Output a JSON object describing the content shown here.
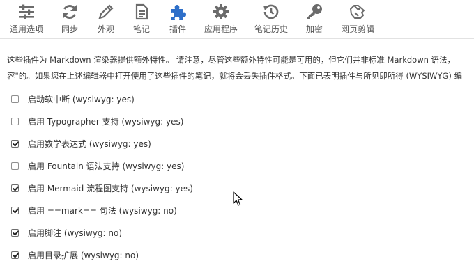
{
  "toolbar": {
    "tabs": [
      {
        "label": "通用选项",
        "icon": "sliders-icon",
        "active": false
      },
      {
        "label": "同步",
        "icon": "sync-icon",
        "active": false
      },
      {
        "label": "外观",
        "icon": "pencil-icon",
        "active": false
      },
      {
        "label": "笔记",
        "icon": "note-icon",
        "active": false
      },
      {
        "label": "插件",
        "icon": "puzzle-icon",
        "active": true
      },
      {
        "label": "应用程序",
        "icon": "gear-icon",
        "active": false
      },
      {
        "label": "笔记历史",
        "icon": "history-icon",
        "active": false
      },
      {
        "label": "加密",
        "icon": "key-icon",
        "active": false
      },
      {
        "label": "网页剪辑",
        "icon": "clipper-icon",
        "active": false
      }
    ]
  },
  "description": {
    "line1": "这些插件为 Markdown 渲染器提供额外特性。 请注意，尽管这些额外特性可能是可用的，但它们并非标准 Markdown 语法，",
    "line2": "容\"的。如果您在上述编辑器中打开使用了这些插件的笔记，就将会丢失插件格式。下面已表明插件与所见即所得 (WYSIWYG) 编"
  },
  "plugins": [
    {
      "label": "启动软中断 (wysiwyg: yes)",
      "checked": false
    },
    {
      "label": "启用 Typographer 支持 (wysiwyg: yes)",
      "checked": false
    },
    {
      "label": "启用数学表达式 (wysiwyg: yes)",
      "checked": true
    },
    {
      "label": "启用 Fountain 语法支持 (wysiwyg: yes)",
      "checked": false
    },
    {
      "label": "启用 Mermaid 流程图支持 (wysiwyg: yes)",
      "checked": true
    },
    {
      "label": "启用 ==mark== 句法 (wysiwyg: no)",
      "checked": true
    },
    {
      "label": "启用脚注 (wysiwyg: no)",
      "checked": true
    },
    {
      "label": "启用目录扩展 (wysiwyg: no)",
      "checked": true
    }
  ],
  "colors": {
    "active_icon": "#2e6fc9",
    "icon": "#6b6b6b"
  }
}
